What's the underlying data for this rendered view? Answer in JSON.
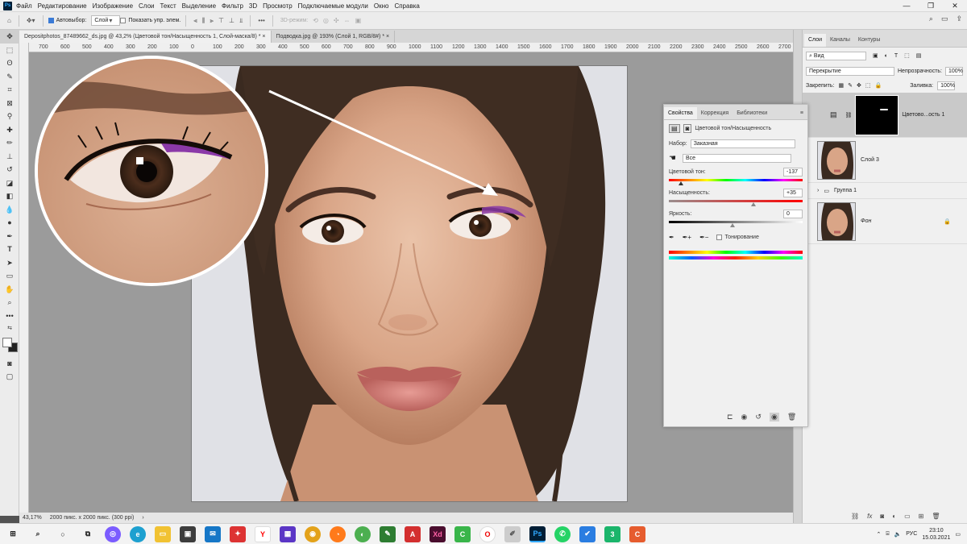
{
  "menu": {
    "items": [
      "Файл",
      "Редактирование",
      "Изображение",
      "Слои",
      "Текст",
      "Выделение",
      "Фильтр",
      "3D",
      "Просмотр",
      "Подключаемые модули",
      "Окно",
      "Справка"
    ]
  },
  "options": {
    "autoselect_label": "Автовыбор:",
    "autoselect_value": "Слой",
    "show_controls_label": "Показать упр. элем.",
    "mode3d_label": "3D-режим:"
  },
  "tabs": [
    {
      "label": "Depositphotos_87489662_ds.jpg @ 43,2% (Цветовой тон/Насыщенность 1, Слой-маска/8) *"
    },
    {
      "label": "Подводка.jpg @ 193% (Слой 1, RGB/8#) *"
    }
  ],
  "ruler_h": [
    "700",
    "600",
    "500",
    "400",
    "300",
    "200",
    "100",
    "0",
    "100",
    "200",
    "300",
    "400",
    "500",
    "600",
    "700",
    "800",
    "900",
    "1000",
    "1100",
    "1200",
    "1300",
    "1400",
    "1500",
    "1600",
    "1700",
    "1800",
    "1900",
    "2000",
    "2100",
    "2200",
    "2300",
    "2400",
    "2500",
    "2600",
    "2700"
  ],
  "status": {
    "zoom": "43,17%",
    "docinfo": "2000 пикс. x 2000 пикс. (300 ppi)"
  },
  "layers_panel": {
    "tabs": [
      "Слои",
      "Каналы",
      "Контуры"
    ],
    "kind": "Вид",
    "blend": "Перекрытие",
    "opacity_label": "Непрозрачность:",
    "opacity": "100%",
    "lock_label": "Закрепить:",
    "fill_label": "Заливка:",
    "fill": "100%",
    "layers": [
      {
        "name": "Цветово...ость 1"
      },
      {
        "name": "Слой 3"
      },
      {
        "name": "Группа 1"
      },
      {
        "name": "Фон"
      }
    ]
  },
  "properties": {
    "tabs": [
      "Свойства",
      "Коррекция",
      "Библиотеки"
    ],
    "title": "Цветовой тон/Насыщенность",
    "preset_label": "Набор:",
    "preset": "Заказная",
    "channel": "Все",
    "hue_label": "Цветовой тон:",
    "hue": "-137",
    "sat_label": "Насыщенность:",
    "sat": "+35",
    "light_label": "Яркость:",
    "light": "0",
    "colorize_label": "Тонирование"
  },
  "taskbar": {
    "lang": "РУС",
    "time": "23:10",
    "date": "15.03.2021"
  }
}
